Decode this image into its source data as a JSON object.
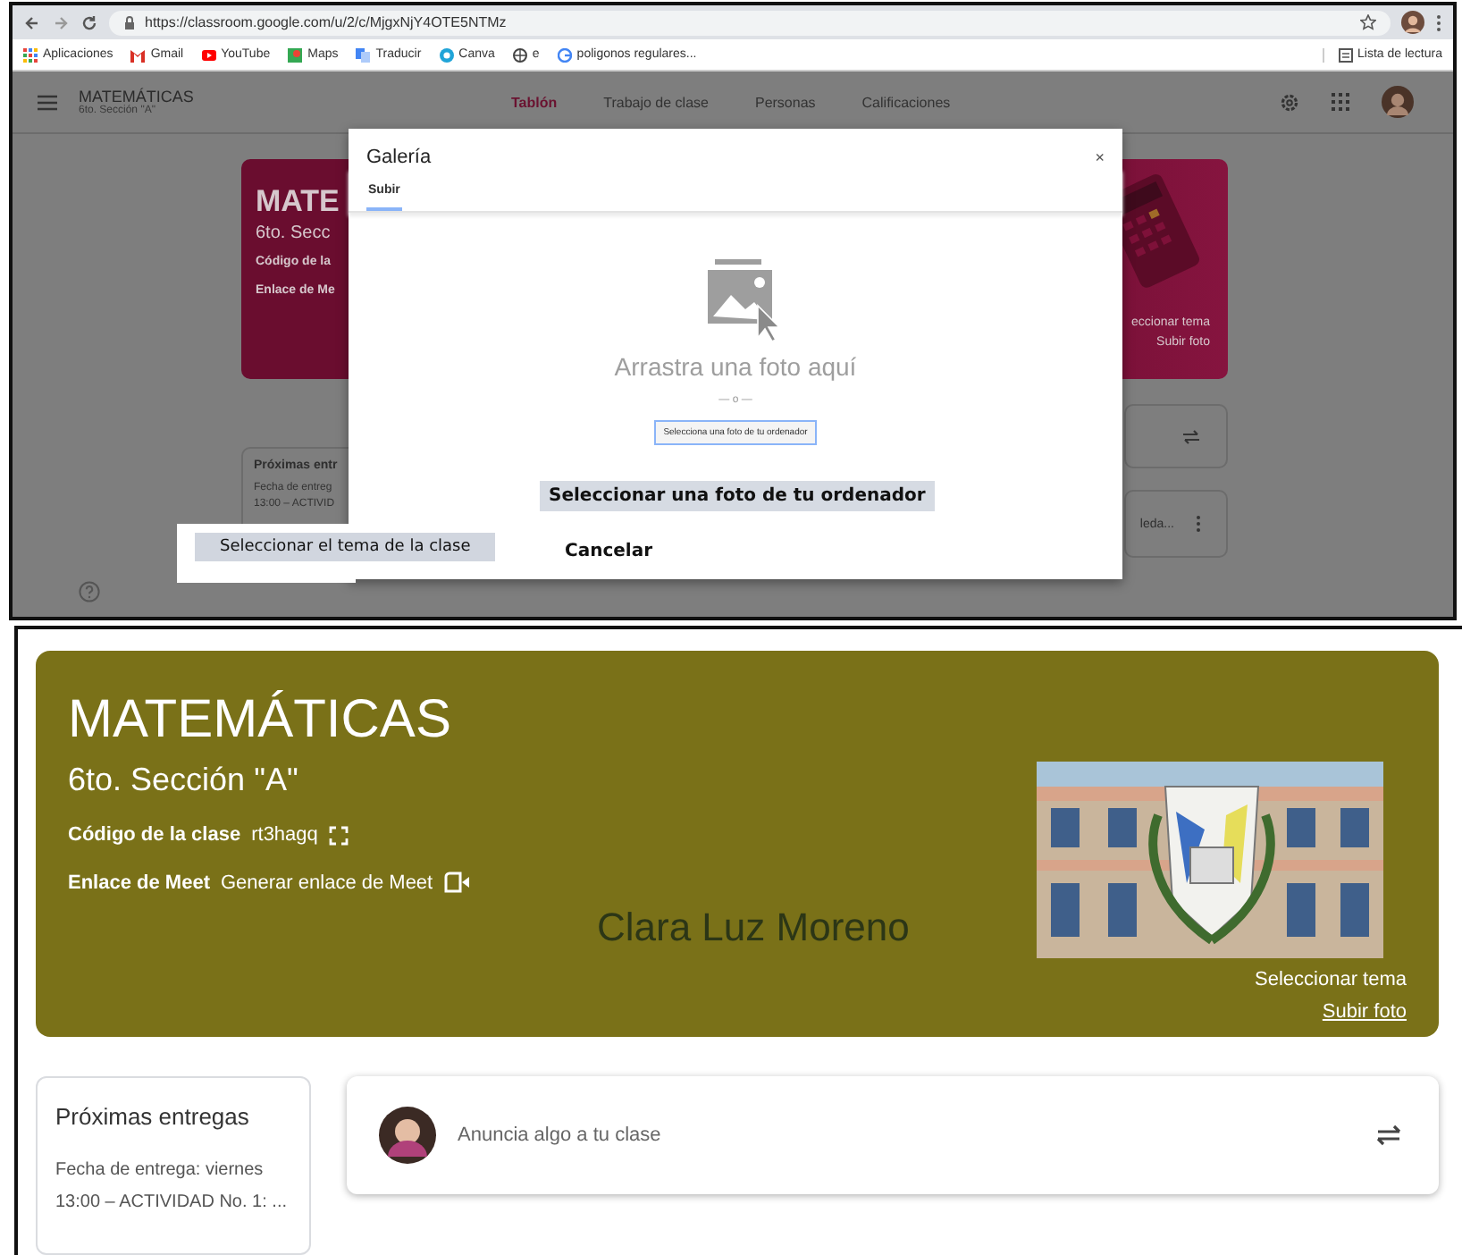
{
  "browser": {
    "url": "https://classroom.google.com/u/2/c/MjgxNjY4OTE5NTMz",
    "bookmarks": [
      {
        "label": "Aplicaciones"
      },
      {
        "label": "Gmail"
      },
      {
        "label": "YouTube"
      },
      {
        "label": "Maps"
      },
      {
        "label": "Traducir"
      },
      {
        "label": "Canva"
      },
      {
        "label": "e"
      },
      {
        "label": "poligonos regulares..."
      }
    ],
    "reading_list": "Lista de lectura"
  },
  "background_page": {
    "title": "MATEMÁTICAS",
    "subtitle": "6to. Sección \"A\"",
    "tabs": [
      {
        "label": "Tablón",
        "selected": true
      },
      {
        "label": "Trabajo de clase",
        "selected": false
      },
      {
        "label": "Personas",
        "selected": false
      },
      {
        "label": "Calificaciones",
        "selected": false
      }
    ],
    "banner_lines": [
      "MATE",
      "6to. Secc",
      "Código de la",
      "Enlace de Me"
    ],
    "banner_links": [
      "eccionar tema",
      "Subir foto"
    ],
    "upcoming": {
      "title": "Próximas entr",
      "lines": [
        "Fecha de entreg",
        "13:00 – ACTIVID"
      ]
    },
    "card_text": "leda..."
  },
  "dialog": {
    "title": "Galería",
    "close": "×",
    "tabs": [
      {
        "label": "Subir",
        "selected": true
      }
    ],
    "drop_text": "Arrastra una foto aquí",
    "separator": "— o —",
    "upload_button": "Selecciona una foto de tu ordenador"
  },
  "callouts": [
    {
      "text": "Seleccionar una foto de tu ordenador"
    },
    {
      "text": "Seleccionar el tema de la clase"
    },
    {
      "text": "Cancelar"
    }
  ],
  "class_page": {
    "title": "MATEMÁTICAS",
    "subtitle": "6to. Sección \"A\"",
    "code_label": "Código de la clase",
    "code": "rt3hagq",
    "meet_label": "Enlace de Meet",
    "meet_link": "Generar enlace de Meet",
    "teacher": "Clara Luz Moreno",
    "select_theme": "Seleccionar tema",
    "upload_photo": "Subir foto",
    "upcoming": {
      "title": "Próximas entregas",
      "lines": [
        "Fecha de entrega: viernes",
        "13:00 – ACTIVIDAD No. 1: ..."
      ]
    },
    "announce_placeholder": "Anuncia algo a tu clase"
  }
}
